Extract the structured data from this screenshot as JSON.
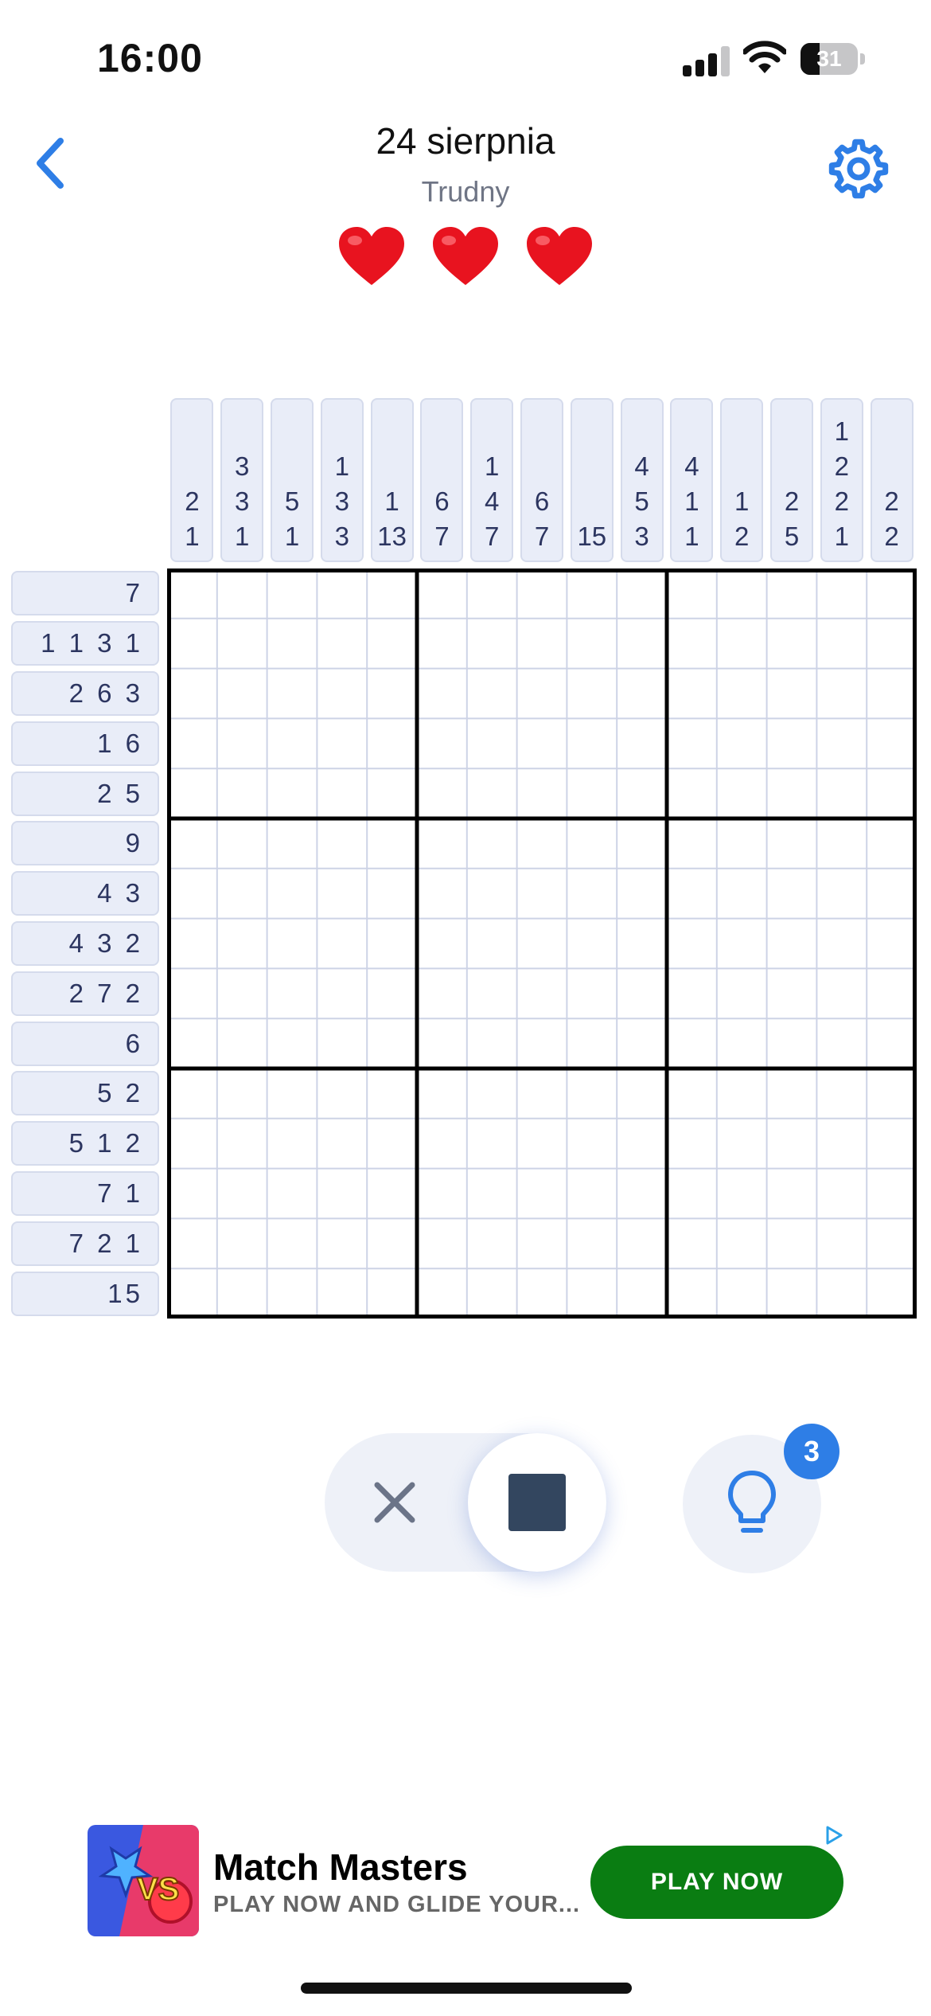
{
  "status": {
    "time": "16:00",
    "battery": "31"
  },
  "header": {
    "title": "24 sierpnia",
    "difficulty": "Trudny",
    "lives": 3,
    "accent_color": "#2e7ee6"
  },
  "puzzle": {
    "size": 15,
    "column_clues": [
      [
        "2",
        "1"
      ],
      [
        "3",
        "3",
        "1"
      ],
      [
        "5",
        "1"
      ],
      [
        "1",
        "3",
        "3"
      ],
      [
        "1",
        "13"
      ],
      [
        "6",
        "7"
      ],
      [
        "1",
        "4",
        "7"
      ],
      [
        "6",
        "7"
      ],
      [
        "15"
      ],
      [
        "4",
        "5",
        "3"
      ],
      [
        "4",
        "1",
        "1"
      ],
      [
        "1",
        "2"
      ],
      [
        "2",
        "5"
      ],
      [
        "1",
        "2",
        "2",
        "1"
      ],
      [
        "2",
        "2"
      ]
    ],
    "row_clues": [
      "7",
      "1 1 3 1",
      "2 6 3",
      "1 6",
      "2 5",
      "9",
      "4 3",
      "4 3 2",
      "2 7 2",
      "6",
      "5 2",
      "5 1 2",
      "7 1",
      "7 2 1",
      "15"
    ]
  },
  "controls": {
    "selected_mode": "fill",
    "hint_count": "3"
  },
  "ad": {
    "title": "Match Masters",
    "subtitle": "PLAY NOW AND GLIDE YOUR...",
    "cta": "PLAY NOW",
    "icon_text": "VS"
  }
}
